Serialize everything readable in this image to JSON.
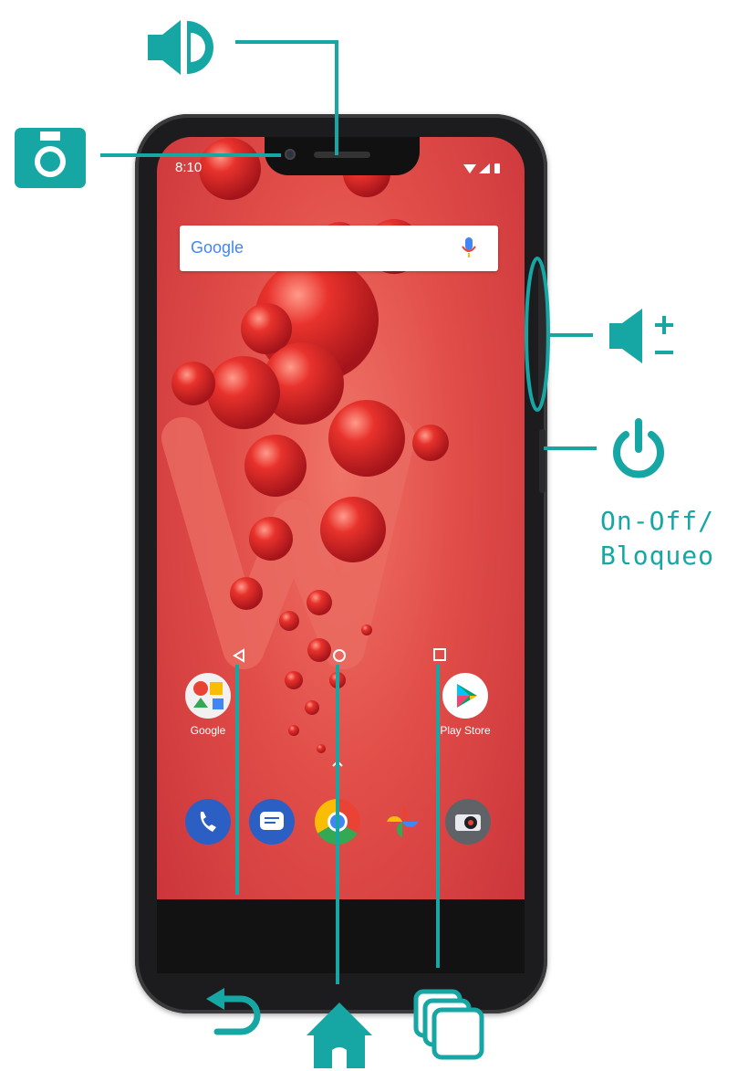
{
  "colors": {
    "accent": "#16a7a5",
    "wallpaper": "#e14d48",
    "phone_body": "#1c1c1e"
  },
  "status_bar": {
    "time": "8:10"
  },
  "search": {
    "brand": "Google"
  },
  "home_apps": [
    {
      "label": "Google",
      "icon": "google-folder-icon"
    },
    {
      "label": "Play Store",
      "icon": "play-store-icon"
    }
  ],
  "dock": [
    {
      "icon": "phone-icon",
      "color": "#2c5fc4"
    },
    {
      "icon": "messages-icon",
      "color": "#2c5fc4"
    },
    {
      "icon": "chrome-icon",
      "color": "#f4c20d"
    },
    {
      "icon": "photos-icon",
      "color": "#ffffff"
    },
    {
      "icon": "camera-app-icon",
      "color": "#5f6368"
    }
  ],
  "callouts": {
    "speaker": "speaker-icon",
    "front_camera": "camera-icon",
    "volume": "volume-icon",
    "power": "power-icon",
    "power_label_line1": "On-Off/",
    "power_label_line2": "Bloqueo",
    "back": "back-arrow-icon",
    "home": "home-icon",
    "recents": "recent-apps-icon"
  }
}
